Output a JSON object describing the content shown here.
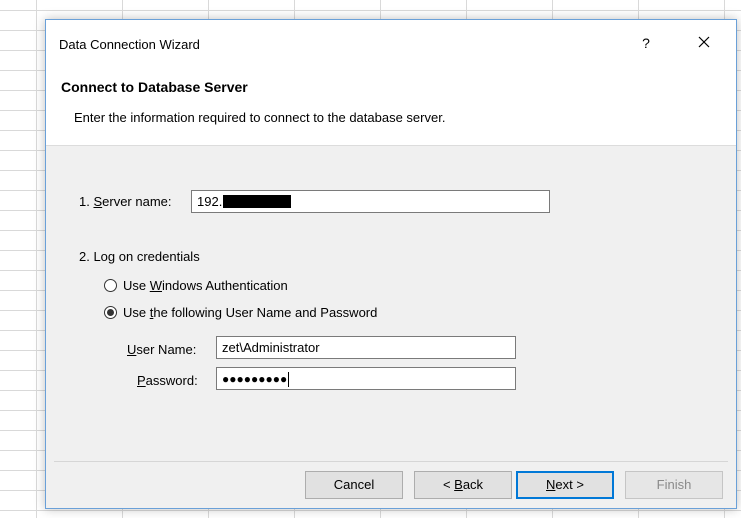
{
  "window": {
    "title": "Data Connection Wizard",
    "help_label": "?"
  },
  "header": {
    "title": "Connect to Database Server",
    "description": "Enter the information required to connect to the database server."
  },
  "server": {
    "label_prefix": "1. ",
    "label_mnemonic": "S",
    "label_rest": "erver name:",
    "value_visible": "192."
  },
  "credentials": {
    "section_label": "2. Log on credentials",
    "options": [
      {
        "pre": "Use ",
        "mnemonic": "W",
        "post": "indows Authentication",
        "checked": false
      },
      {
        "pre": "Use ",
        "mnemonic": "t",
        "post": "he following User Name and Password",
        "checked": true
      }
    ],
    "username_label_mnemonic": "U",
    "username_label_rest": "ser Name:",
    "username_value": "zet\\Administrator",
    "password_label_mnemonic": "P",
    "password_label_rest": "assword:",
    "password_mask": "●●●●●●●●●"
  },
  "buttons": {
    "cancel": "Cancel",
    "back_pre": "< ",
    "back_mnemonic": "B",
    "back_post": "ack",
    "next_mnemonic": "N",
    "next_post": "ext >",
    "finish": "Finish"
  },
  "colors": {
    "accent": "#0078d7",
    "dialog_bg": "#f0f0f0",
    "border": "#6aa0d8"
  }
}
